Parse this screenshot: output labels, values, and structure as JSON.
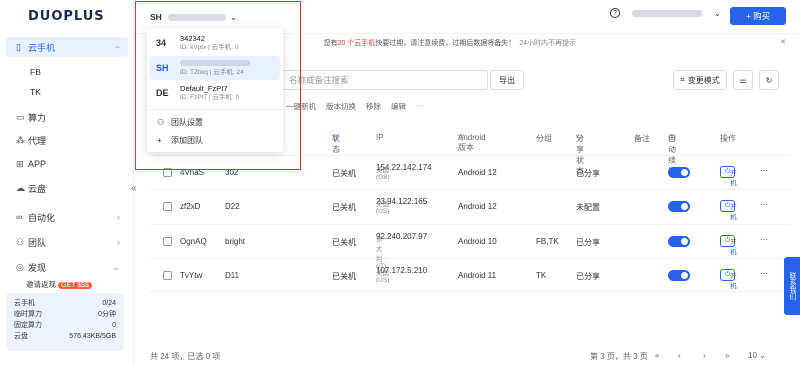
{
  "brand": {
    "logo": "DUOPLUS"
  },
  "sidebar": {
    "items": [
      {
        "label": "云手机",
        "icon": "phone-icon"
      },
      {
        "label": "FB"
      },
      {
        "label": "TK"
      },
      {
        "label": "算力",
        "icon": "compute-icon"
      },
      {
        "label": "代理",
        "icon": "proxy-icon"
      },
      {
        "label": "APP",
        "icon": "app-icon"
      },
      {
        "label": "云盘",
        "icon": "cloud-icon"
      },
      {
        "label": "自动化",
        "icon": "automation-icon"
      },
      {
        "label": "团队",
        "icon": "team-icon"
      },
      {
        "label": "发现",
        "icon": "discover-icon"
      },
      {
        "label": "邀请返现",
        "badge": "GET $$$"
      }
    ],
    "stats": [
      {
        "label": "云手机",
        "value": "0/24"
      },
      {
        "label": "临时算力",
        "value": "0分钟"
      },
      {
        "label": "固定算力",
        "value": "0"
      },
      {
        "label": "云盘",
        "value": "576.43KB/5GB"
      }
    ]
  },
  "topbar": {
    "team_abbr": "SH",
    "buy_label": "+ 购买"
  },
  "notice": {
    "pre": "您有",
    "count": "20 个云手机",
    "post": "快要过期，请注意续费，过期后数据将备失！",
    "link": "24小时内不再提示"
  },
  "search": {
    "placeholder": "名称或备注搜索"
  },
  "actions": {
    "export": "导出",
    "view_mode": "变更模式"
  },
  "toolbar2": [
    "一键新机",
    "版本切换",
    "移除",
    "编辑",
    "···"
  ],
  "table": {
    "headers": [
      "状态",
      "IP",
      "Android 版本",
      "分组",
      "分享状态",
      "备注",
      "自动续期",
      "操作"
    ],
    "rows": [
      {
        "name": "4VhaS",
        "remark": "302",
        "status": "已关机",
        "ip": "154.22.142.174",
        "region": "英国(GB)",
        "android": "Android 12",
        "group": "",
        "share": "已分享",
        "power": "开机"
      },
      {
        "name": "zf2xD",
        "remark": "D22",
        "status": "已关机",
        "ip": "23.94.122.165",
        "region": "美国(US)",
        "android": "Android 12",
        "group": "",
        "share": "未配置",
        "power": "开机"
      },
      {
        "name": "OgnAQ",
        "remark": "bright",
        "status": "已关机",
        "ip": "92.240.207.97",
        "region": "意大利(IT)",
        "android": "Android 10",
        "group": "FB,TK",
        "share": "已分享",
        "power": "开机"
      },
      {
        "name": "TvYtw",
        "remark": "D11",
        "status": "已关机",
        "ip": "107.172.5.210",
        "region": "美国(US)",
        "android": "Android 11",
        "group": "TK",
        "share": "已分享",
        "power": "开机"
      }
    ]
  },
  "footer": {
    "summary": "共 24 项，已选 0 项",
    "page": "第 3 页，共 3 页",
    "page_size": "10"
  },
  "dropdown": {
    "teams": [
      {
        "abbr": "34",
        "name": "342342",
        "sub": "ID: kVptx | 云手机: 0"
      },
      {
        "abbr": "SH",
        "name": "",
        "sub": "ID: TZtwq | 云手机: 24"
      },
      {
        "abbr": "DE",
        "name": "Default_FzPI7",
        "sub": "ID: FzPI7 | 云手机: 0"
      }
    ],
    "settings": "团队设置",
    "add": "添加团队"
  },
  "contact": "联系我们"
}
